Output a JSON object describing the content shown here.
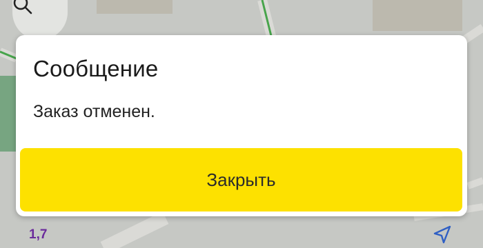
{
  "map": {
    "scale_label": "1,7"
  },
  "dialog": {
    "title": "Сообщение",
    "message": "Заказ отменен.",
    "close_label": "Закрыть"
  },
  "colors": {
    "accent_yellow": "#fde100",
    "scale_purple": "#6a2a9b"
  },
  "icons": [
    "search-icon",
    "navigation-arrow-icon"
  ]
}
